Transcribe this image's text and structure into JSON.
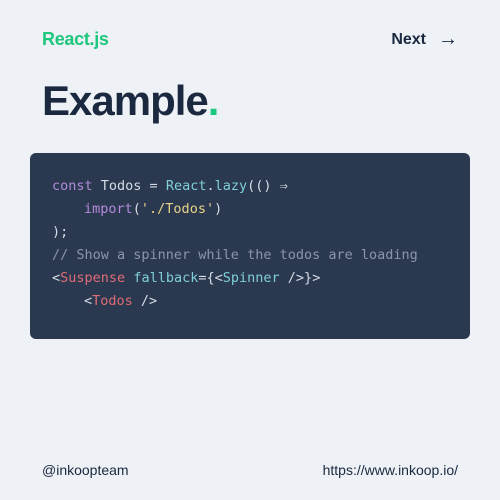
{
  "header": {
    "brand": "React.js",
    "next_label": "Next"
  },
  "title": {
    "text": "Example",
    "suffix": "."
  },
  "code": {
    "line1_const": "const",
    "line1_name": " Todos ",
    "line1_eq": "= ",
    "line1_react": "React",
    "line1_dot": ".",
    "line1_lazy": "lazy",
    "line1_arrow": "(() ⇒",
    "line2_import": "import",
    "line2_paren": "(",
    "line2_str": "'./Todos'",
    "line2_close": ")",
    "line3": ");",
    "blank": " ",
    "line5": "// Show a spinner while the todos are loading",
    "line6_open": "<",
    "line6_tag": "Suspense",
    "line6_sp": " ",
    "line6_attr": "fallback",
    "line6_eq": "={",
    "line6_open2": "<",
    "line6_spinner": "Spinner",
    "line6_selfclose": " />",
    "line6_closebrace": "}",
    "line6_gt": ">",
    "line7_open": "<",
    "line7_tag": "Todos",
    "line7_close": " />"
  },
  "footer": {
    "handle": "@inkoopteam",
    "url": "https://www.inkoop.io/"
  }
}
